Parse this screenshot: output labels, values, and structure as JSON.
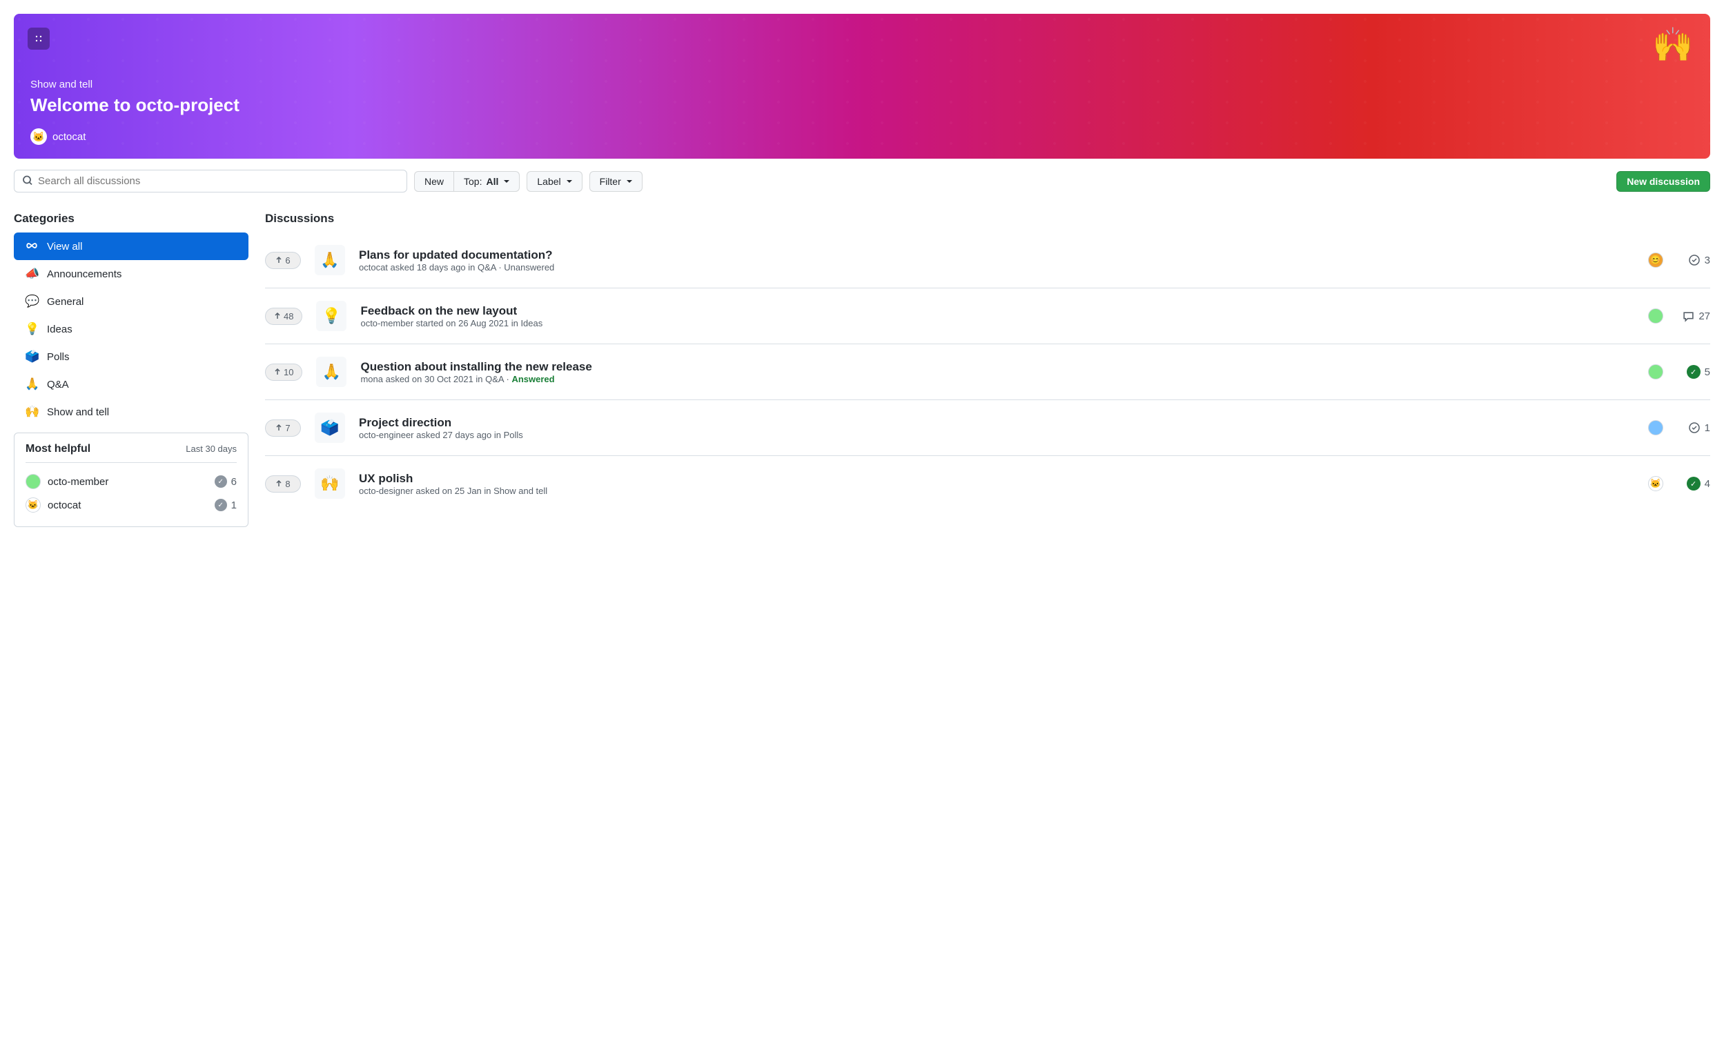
{
  "banner": {
    "category": "Show and tell",
    "title": "Welcome to octo-project",
    "author": "octocat",
    "emoji": "🙌"
  },
  "toolbar": {
    "search_placeholder": "Search all discussions",
    "new_label": "New",
    "top_prefix": "Top: ",
    "top_value": "All",
    "label_label": "Label",
    "filter_label": "Filter",
    "new_discussion_label": "New discussion"
  },
  "sidebar": {
    "categories_heading": "Categories",
    "categories": [
      {
        "emoji": "∞",
        "label": "View all",
        "active": true
      },
      {
        "emoji": "📣",
        "label": "Announcements",
        "active": false
      },
      {
        "emoji": "💬",
        "label": "General",
        "active": false
      },
      {
        "emoji": "💡",
        "label": "Ideas",
        "active": false
      },
      {
        "emoji": "🗳️",
        "label": "Polls",
        "active": false
      },
      {
        "emoji": "🙏",
        "label": "Q&A",
        "active": false
      },
      {
        "emoji": "🙌",
        "label": "Show and tell",
        "active": false
      }
    ],
    "helpful_heading": "Most helpful",
    "helpful_period": "Last 30 days",
    "helpful_users": [
      {
        "name": "octo-member",
        "count": "6",
        "avatar_bg": "#7ee787"
      },
      {
        "name": "octocat",
        "count": "1",
        "avatar_bg": "#ffffff"
      }
    ]
  },
  "main": {
    "heading": "Discussions",
    "items": [
      {
        "upvotes": "6",
        "category_emoji": "🙏",
        "title": "Plans for updated documentation?",
        "meta": "octocat asked 18 days ago in Q&A · ",
        "status": "Unanswered",
        "status_type": "unanswered",
        "avatar_bg": "#f0a030",
        "avatar_char": "😊",
        "comments": "3",
        "comment_icon": "check-circle"
      },
      {
        "upvotes": "48",
        "category_emoji": "💡",
        "title": "Feedback on the new layout",
        "meta": "octo-member started on 26 Aug 2021 in Ideas",
        "status": "",
        "status_type": "",
        "avatar_bg": "#7ee787",
        "avatar_char": "",
        "comments": "27",
        "comment_icon": "comment"
      },
      {
        "upvotes": "10",
        "category_emoji": "🙏",
        "title": "Question about installing the new release",
        "meta": "mona asked on 30 Oct 2021 in Q&A · ",
        "status": "Answered",
        "status_type": "answered",
        "avatar_bg": "#7ee787",
        "avatar_char": "",
        "comments": "5",
        "comment_icon": "check-filled"
      },
      {
        "upvotes": "7",
        "category_emoji": "🗳️",
        "title": "Project direction",
        "meta": "octo-engineer asked 27 days ago in Polls",
        "status": "",
        "status_type": "",
        "avatar_bg": "#79c0ff",
        "avatar_char": "",
        "comments": "1",
        "comment_icon": "check-circle"
      },
      {
        "upvotes": "8",
        "category_emoji": "🙌",
        "title": "UX polish",
        "meta": "octo-designer asked on 25 Jan in Show and tell",
        "status": "",
        "status_type": "",
        "avatar_bg": "#ffffff",
        "avatar_char": "🐱",
        "comments": "4",
        "comment_icon": "check-filled"
      }
    ]
  }
}
